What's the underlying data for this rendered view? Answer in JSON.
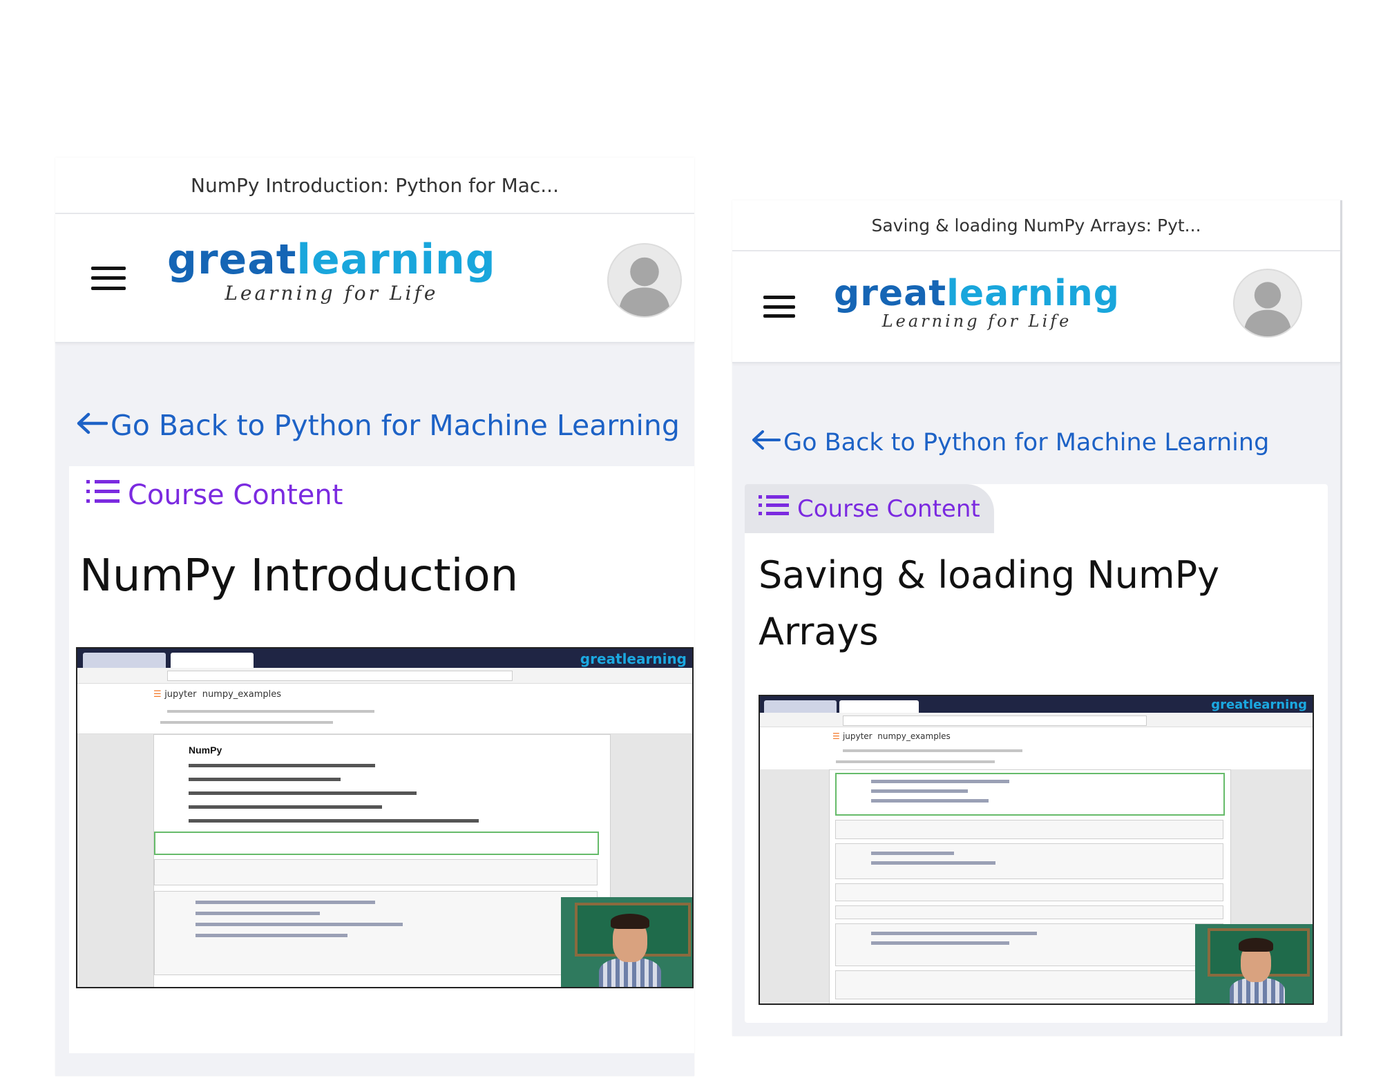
{
  "left": {
    "title_bar": "NumPy Introduction: Python for Mac...",
    "logo": {
      "great": "great",
      "learning": "learning",
      "tagline": "Learning for Life"
    },
    "back_link": "Go Back to Python for Machine Learning",
    "course_content": "Course Content",
    "lesson_title": "NumPy Introduction",
    "video": {
      "brand": "greatlearning",
      "jupyter": "jupyter",
      "notebook": "numpy_examples",
      "heading": "NumPy"
    }
  },
  "right": {
    "title_bar": "Saving & loading NumPy Arrays: Pyt...",
    "logo": {
      "great": "great",
      "learning": "learning",
      "tagline": "Learning for Life"
    },
    "back_link": "Go Back to Python for Machine Learning",
    "course_content": "Course Content",
    "lesson_title_line1": "Saving & loading NumPy",
    "lesson_title_line2": "Arrays",
    "video": {
      "brand": "greatlearning",
      "jupyter": "jupyter",
      "notebook": "numpy_examples"
    }
  },
  "icons": {
    "hamburger": "hamburger-menu-icon",
    "avatar": "user-avatar-icon",
    "back": "arrow-left-icon",
    "list": "list-icon"
  },
  "colors": {
    "brand_dark_blue": "#1565b5",
    "brand_light_blue": "#19a6dc",
    "link_blue": "#1d62c6",
    "course_purple": "#7b2ae0"
  }
}
